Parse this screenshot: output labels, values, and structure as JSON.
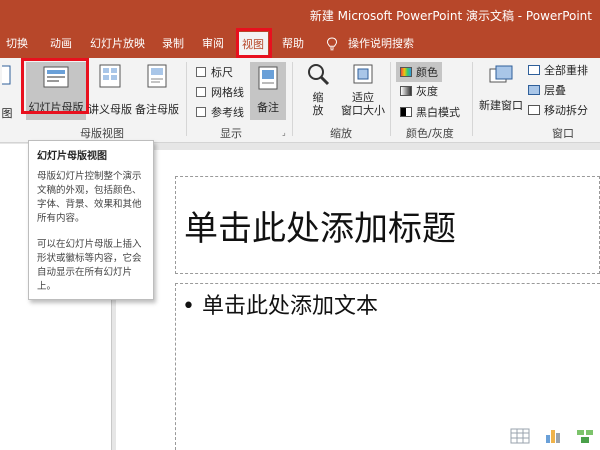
{
  "window": {
    "title": "新建 Microsoft PowerPoint 演示文稿 - PowerPoint"
  },
  "tabs": [
    {
      "label": "切换"
    },
    {
      "label": "动画"
    },
    {
      "label": "幻灯片放映"
    },
    {
      "label": "录制"
    },
    {
      "label": "审阅"
    },
    {
      "label": "视图",
      "active": true
    },
    {
      "label": "帮助"
    },
    {
      "label": "操作说明搜索"
    }
  ],
  "ribbon": {
    "master_views": {
      "partial_label": "图",
      "slide_master": "幻灯片母版",
      "handout_master": "讲义母版",
      "notes_master": "备注母版",
      "group_label": "母版视图"
    },
    "show": {
      "ruler": "标尺",
      "gridlines": "网格线",
      "guides": "参考线",
      "notes": "备注",
      "group_label": "显示"
    },
    "zoom": {
      "zoom": "缩\n放",
      "fit_window": "适应\n窗口大小",
      "group_label": "缩放"
    },
    "color": {
      "color": "颜色",
      "grayscale": "灰度",
      "bw": "黑白模式",
      "group_label": "颜色/灰度"
    },
    "window": {
      "new_window": "新建窗口",
      "arrange_all": "全部重排",
      "cascade": "层叠",
      "move_split": "移动拆分",
      "group_label": "窗口"
    }
  },
  "tooltip": {
    "title": "幻灯片母版视图",
    "para1": "母版幻灯片控制整个演示文稿的外观，包括颜色、字体、背景、效果和其他所有内容。",
    "para2": "可以在幻灯片母版上插入形状或徽标等内容，它会自动显示在所有幻灯片上。"
  },
  "slide": {
    "title_placeholder": "单击此处添加标题",
    "body_placeholder": "• 单击此处添加文本"
  },
  "colors": {
    "accent": "#b7472a",
    "highlight": "#e8101e",
    "ribbon_bg": "#f3f3f3"
  }
}
